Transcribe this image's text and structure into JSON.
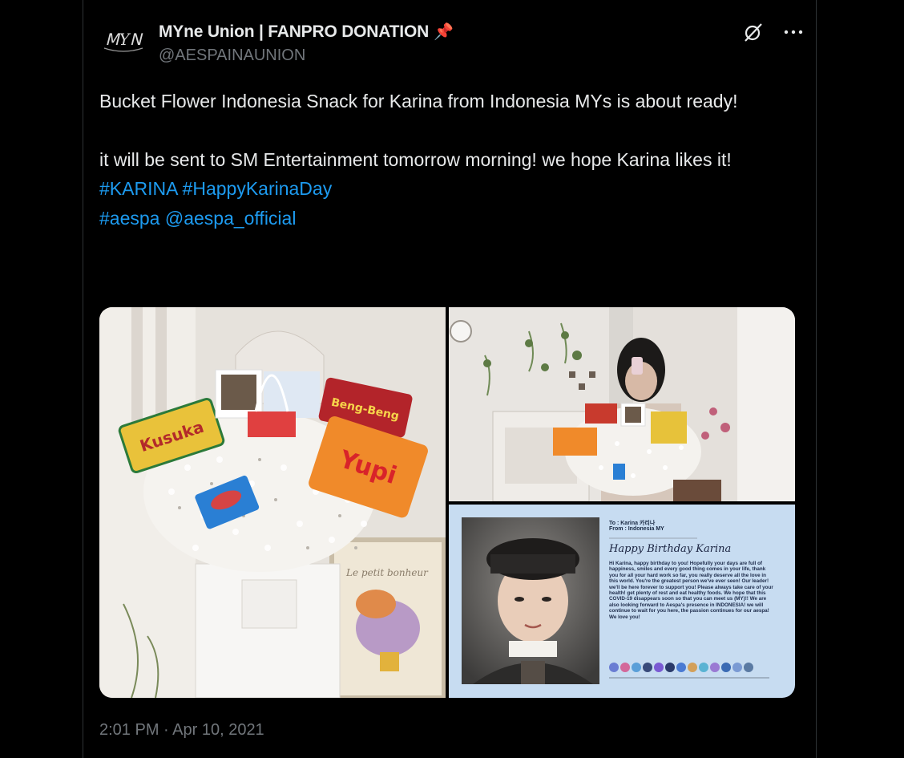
{
  "author": {
    "display_name": "MYne Union | FANPRO DONATION",
    "pin_emoji": "📌",
    "handle": "@AESPAINAUNION",
    "avatar_text": "ꓟYꓠ"
  },
  "post": {
    "line1": "Bucket Flower Indonesia Snack for Karina from Indonesia MYs is about ready!",
    "line2": "it will be sent to SM Entertainment tomorrow morning! we hope Karina likes it!",
    "tag_karina": "#KARINA",
    "tag_day": "#HappyKarinaDay",
    "tag_aespa": "#aespa",
    "mention": "@aespa_official",
    "timestamp": "2:01 PM · Apr 10, 2021"
  },
  "media": {
    "photo1": {
      "snack_kusuka": "Kusuka",
      "snack_yupi": "Yupi",
      "snack_bengbeng": "Beng-Beng"
    },
    "card": {
      "to": "To : Karina 카리나",
      "from": "From : Indonesia MY",
      "title": "Happy Birthday Karina",
      "message": "Hi Karina, happy birthday to you! Hopefully your days are full of happiness, smiles and every good thing comes in your life, thank you for all your hard work so far, you really deserve all the love in this world. You're the greatest person we've ever seen! Our leader! we'll be here forever to support you! Please always take care of your health! get plenty of rest and eat healthy foods. We hope that this COVID-19 disappears soon so that you can meet us (MY)!! We are also looking forward to Aespa's presence in INDONESIA! we will continue to wait for you here, the passion continues for our aespa! We love you!"
    }
  },
  "colors": {
    "background": "#000000",
    "text": "#e7e9ea",
    "secondary": "#71767b",
    "link": "#1d9bf0",
    "pin": "#f4212e"
  },
  "icons": {
    "grok": "grok-icon",
    "more": "more-icon"
  }
}
